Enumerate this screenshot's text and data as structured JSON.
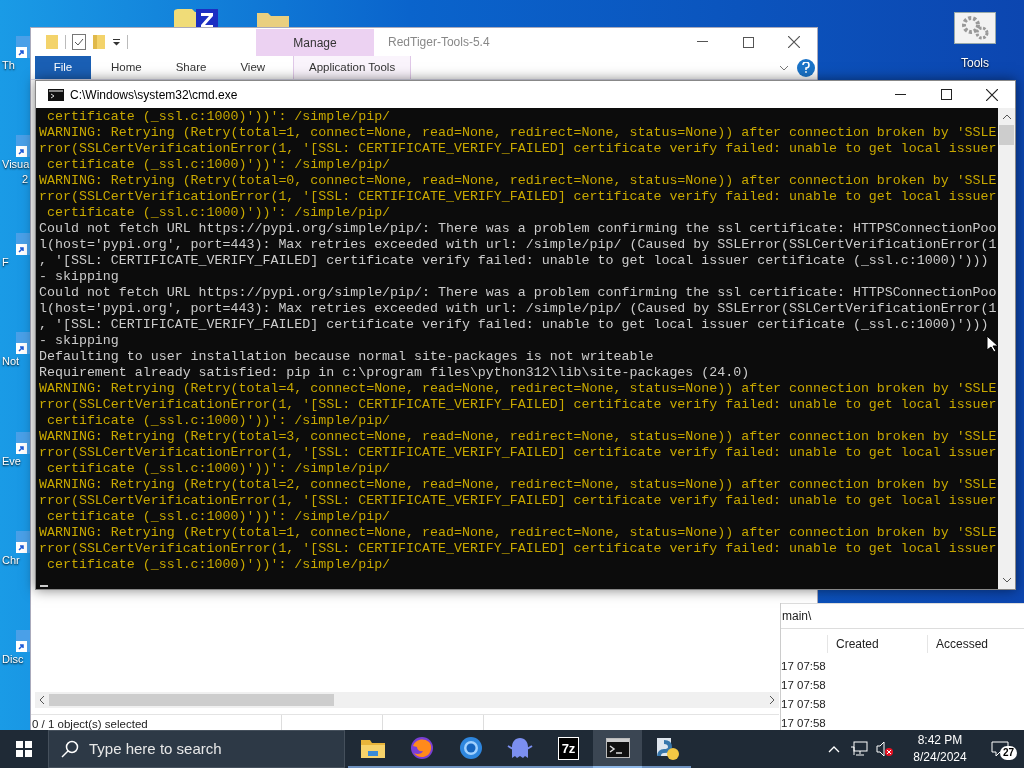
{
  "desktop": {
    "left_icons": [
      {
        "lines": [
          "Th"
        ]
      },
      {
        "lines": [
          "Visua",
          "2"
        ]
      },
      {
        "lines": [
          "F"
        ]
      },
      {
        "lines": [
          "Not"
        ]
      },
      {
        "lines": [
          "Eve"
        ]
      },
      {
        "lines": [
          "Chr"
        ]
      },
      {
        "lines": [
          "Disc"
        ]
      }
    ],
    "right_icons": [
      {
        "label": "Tools"
      }
    ]
  },
  "explorer": {
    "title": "RedTiger-Tools-5.4",
    "context_tab": "Manage",
    "tabs": [
      {
        "label": "File",
        "kind": "file"
      },
      {
        "label": "Home",
        "kind": "plain"
      },
      {
        "label": "Share",
        "kind": "plain"
      },
      {
        "label": "View",
        "kind": "plain"
      },
      {
        "label": "Application Tools",
        "kind": "context"
      }
    ],
    "status": "0 / 1 object(s) selected"
  },
  "explorer_2": {
    "address": "main\\",
    "columns": [
      "Created",
      "Accessed"
    ],
    "rows": [
      {
        "column_1": "17 07:58"
      },
      {
        "column_1": "17 07:58"
      },
      {
        "column_1": "17 07:58"
      },
      {
        "column_1": "17 07:58"
      }
    ]
  },
  "cmd": {
    "title": "C:\\Windows\\system32\\cmd.exe",
    "lines": [
      {
        "kind": "warning",
        "text": " certificate (_ssl.c:1000)'))': /simple/pip/"
      },
      {
        "kind": "warning",
        "text": "WARNING: Retrying (Retry(total=1, connect=None, read=None, redirect=None, status=None)) after connection broken by 'SSLE"
      },
      {
        "kind": "warning",
        "text": "rror(SSLCertVerificationError(1, '[SSL: CERTIFICATE_VERIFY_FAILED] certificate verify failed: unable to get local issuer"
      },
      {
        "kind": "warning",
        "text": " certificate (_ssl.c:1000)'))': /simple/pip/"
      },
      {
        "kind": "warning",
        "text": "WARNING: Retrying (Retry(total=0, connect=None, read=None, redirect=None, status=None)) after connection broken by 'SSLE"
      },
      {
        "kind": "warning",
        "text": "rror(SSLCertVerificationError(1, '[SSL: CERTIFICATE_VERIFY_FAILED] certificate verify failed: unable to get local issuer"
      },
      {
        "kind": "warning",
        "text": " certificate (_ssl.c:1000)'))': /simple/pip/"
      },
      {
        "kind": "normal",
        "text": "Could not fetch URL https://pypi.org/simple/pip/: There was a problem confirming the ssl certificate: HTTPSConnectionPoo"
      },
      {
        "kind": "normal",
        "text": "l(host='pypi.org', port=443): Max retries exceeded with url: /simple/pip/ (Caused by SSLError(SSLCertVerificationError(1"
      },
      {
        "kind": "normal",
        "text": ", '[SSL: CERTIFICATE_VERIFY_FAILED] certificate verify failed: unable to get local issuer certificate (_ssl.c:1000)')))"
      },
      {
        "kind": "normal",
        "text": "- skipping"
      },
      {
        "kind": "normal",
        "text": "Could not fetch URL https://pypi.org/simple/pip/: There was a problem confirming the ssl certificate: HTTPSConnectionPoo"
      },
      {
        "kind": "normal",
        "text": "l(host='pypi.org', port=443): Max retries exceeded with url: /simple/pip/ (Caused by SSLError(SSLCertVerificationError(1"
      },
      {
        "kind": "normal",
        "text": ", '[SSL: CERTIFICATE_VERIFY_FAILED] certificate verify failed: unable to get local issuer certificate (_ssl.c:1000)')))"
      },
      {
        "kind": "normal",
        "text": "- skipping"
      },
      {
        "kind": "normal",
        "text": "Defaulting to user installation because normal site-packages is not writeable"
      },
      {
        "kind": "normal",
        "text": "Requirement already satisfied: pip in c:\\program files\\python312\\lib\\site-packages (24.0)"
      },
      {
        "kind": "warning",
        "text": "WARNING: Retrying (Retry(total=4, connect=None, read=None, redirect=None, status=None)) after connection broken by 'SSLE"
      },
      {
        "kind": "warning",
        "text": "rror(SSLCertVerificationError(1, '[SSL: CERTIFICATE_VERIFY_FAILED] certificate verify failed: unable to get local issuer"
      },
      {
        "kind": "warning",
        "text": " certificate (_ssl.c:1000)'))': /simple/pip/"
      },
      {
        "kind": "warning",
        "text": "WARNING: Retrying (Retry(total=3, connect=None, read=None, redirect=None, status=None)) after connection broken by 'SSLE"
      },
      {
        "kind": "warning",
        "text": "rror(SSLCertVerificationError(1, '[SSL: CERTIFICATE_VERIFY_FAILED] certificate verify failed: unable to get local issuer"
      },
      {
        "kind": "warning",
        "text": " certificate (_ssl.c:1000)'))': /simple/pip/"
      },
      {
        "kind": "warning",
        "text": "WARNING: Retrying (Retry(total=2, connect=None, read=None, redirect=None, status=None)) after connection broken by 'SSLE"
      },
      {
        "kind": "warning",
        "text": "rror(SSLCertVerificationError(1, '[SSL: CERTIFICATE_VERIFY_FAILED] certificate verify failed: unable to get local issuer"
      },
      {
        "kind": "warning",
        "text": " certificate (_ssl.c:1000)'))': /simple/pip/"
      },
      {
        "kind": "warning",
        "text": "WARNING: Retrying (Retry(total=1, connect=None, read=None, redirect=None, status=None)) after connection broken by 'SSLE"
      },
      {
        "kind": "warning",
        "text": "rror(SSLCertVerificationError(1, '[SSL: CERTIFICATE_VERIFY_FAILED] certificate verify failed: unable to get local issuer"
      },
      {
        "kind": "warning",
        "text": " certificate (_ssl.c:1000)'))': /simple/pip/"
      }
    ]
  },
  "taskbar": {
    "search_placeholder": "Type here to search",
    "apps": [
      {
        "kind": "folder",
        "selected": false
      },
      {
        "kind": "fox",
        "selected": false
      },
      {
        "kind": "globe",
        "selected": false
      },
      {
        "kind": "ghost",
        "selected": false
      },
      {
        "kind": "archive",
        "label": "7z",
        "selected": false
      },
      {
        "kind": "terminal",
        "selected": true
      },
      {
        "kind": "tool",
        "selected": false
      }
    ],
    "time": "8:42 PM",
    "date": "8/24/2024",
    "notifications": "27"
  }
}
